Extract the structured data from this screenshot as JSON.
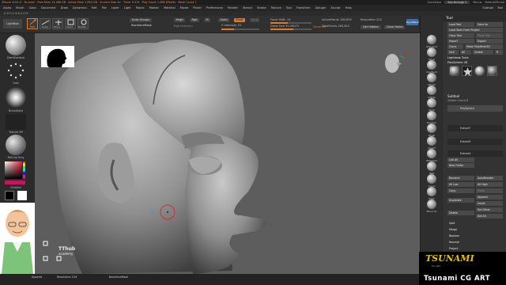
{
  "titlebar": {
    "app_title": "ZBrush 2021.6 · Tsunami · Free Mem 13.488 GB · Active Mem 1.893 GB · Scratch Disk 44 · Timer 0.014 · Poly Count 1.088 KPoints · Mesh Count 7",
    "quick_save": "QuickSave",
    "see_through": "See-through 0",
    "menus": "Menus",
    "default_script": "DefaultZScript"
  },
  "menu": {
    "items": [
      "Alpha",
      "Brush",
      "Color",
      "Document",
      "Draw",
      "Dynamics",
      "Edit",
      "File",
      "Layer",
      "Light",
      "Macro",
      "Marker",
      "Material",
      "Movie",
      "Picker",
      "Preferences",
      "Render",
      "Stencil",
      "Stroke",
      "Texture",
      "Tool",
      "Transform",
      "Zplugin",
      "Zscript",
      "Help"
    ],
    "right": [
      "Subtool",
      "Tool"
    ]
  },
  "coords": "-0.453,0.916,0.078",
  "topshelf": {
    "lightbox": "LightBox",
    "edit": "Edit",
    "draw": "Draw",
    "move": "Move",
    "scale": "Scale",
    "rotate": "Rotate",
    "auto_groups": "Auto Groups",
    "backface_mask": "BackfaceMask",
    "mrgb": "Mrgb",
    "rgb": "Rgb",
    "m": "M",
    "zadd": "Zadd",
    "zsub": "Zsub",
    "zcut": "Zcut",
    "rgb_intensity_label": "Rgb Intensity",
    "z_intensity_label": "Z Intensity",
    "z_intensity_value": "33",
    "z_intensity_fraction": 0.33,
    "focal_shift_label": "Focal Shift",
    "focal_shift_value": "-14",
    "focal_shift_fraction": 0.43,
    "draw_size_label": "Draw Size",
    "draw_size_value": "55.26072",
    "draw_size_fraction": 0.55,
    "dynamic": "Dynamic",
    "active_points_label": "ActivePoints",
    "active_points_value": "180,692",
    "total_points_label": "TotalPoints",
    "total_points_value": "285,815",
    "resolution_label": "Resolution",
    "resolution_value": "224",
    "del_hidden": "Del Hidden",
    "close_holes": "Close Holes",
    "dynamesh": "DynaMesh"
  },
  "leftshelf": {
    "brush_label": "DamStandard",
    "stroke_label": "Dots",
    "alpha_label": "BrushAlpha",
    "texture_label": "Texture Off",
    "material_label": "MatCap Gray",
    "gradient_label": "Gradient"
  },
  "viewport": {
    "watermark_line1": "TThub",
    "watermark_line2": "academy"
  },
  "rightshelf": {
    "items": [
      "Standard",
      "Move",
      "ClayBuild",
      "hPolish",
      "Inflate",
      "Pinch",
      "TrimDyn",
      "Polish",
      "Slash3",
      "ZModeler",
      "IMM",
      "Curve",
      "Mask",
      "Move Tp"
    ]
  },
  "toolpanel": {
    "title": "Tool",
    "load_tool": "Load Tool",
    "save_as": "Save As",
    "load_tools_from_project": "Load Tools From Project",
    "copy_tool": "Copy Tool",
    "paste_tool": "Paste Tool",
    "import": "Import",
    "export": "Export",
    "clone": "Clone",
    "make_polymesh3d": "Make PolyMesh3D",
    "goz": "GoZ",
    "all": "All",
    "visible": "Visible",
    "r": "R",
    "lightbox_tools": "Lightbox▸ Tools",
    "polysphere_label": "PolySphere",
    "polysphere_count": "48",
    "subtool_title": "Subtool",
    "visible_count": "Visible Count 8",
    "subtools": [
      "PolySphere",
      "Extract7",
      "Extract5",
      "Extract4"
    ],
    "list_all": "List All",
    "new_folder": "New Folder",
    "rename": "Rename",
    "auto_reorder": "AutoReorder",
    "all_low": "All Low",
    "all_high": "All High",
    "copy": "Copy",
    "paste": "Paste",
    "duplicate": "Duplicate",
    "append": "Append",
    "insert": "Insert",
    "delete": "Delete",
    "del_other": "Del Other",
    "del_all": "Del All",
    "split": "Split",
    "merge": "Merge",
    "boolean": "Boolean",
    "remesh": "Remesh",
    "project": "Project"
  },
  "bottombar": {
    "append": "Append",
    "resolution": "Resolution 224",
    "backface_mask": "BackfaceMask"
  },
  "logo": {
    "brand": "TSUNAMI",
    "tag": "CG ART",
    "caption": "Tsunami CG ART"
  },
  "colors": {
    "accent_orange": "#e07a2a",
    "viewport_bg": "#5d5d5d",
    "logo_yellow": "#e8c200",
    "button_blue": "#3d6ea8"
  }
}
